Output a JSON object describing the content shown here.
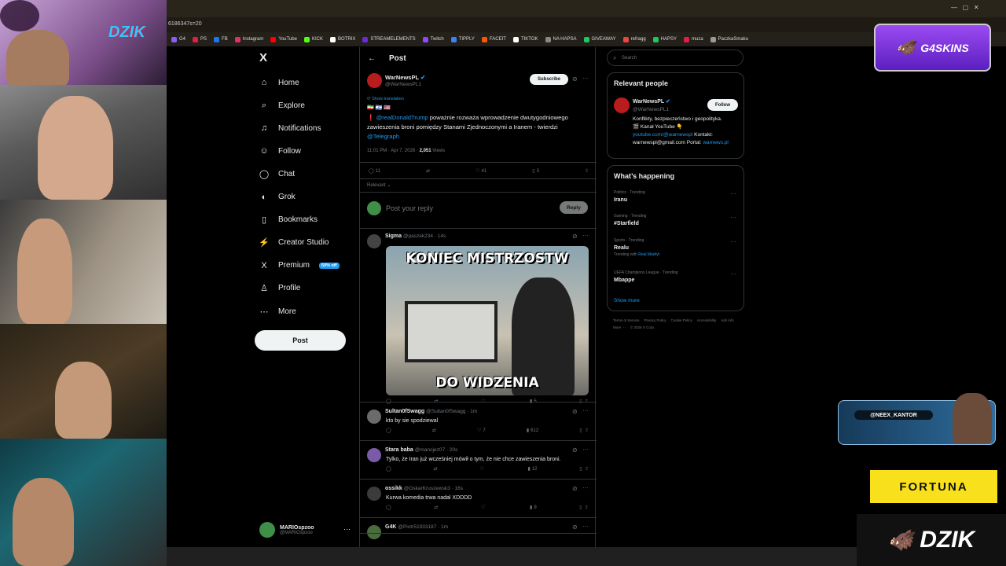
{
  "browser": {
    "url": "6186347s=20",
    "bookmarks": [
      "G4",
      "PS",
      "FB",
      "Instagram",
      "YouTube",
      "KICK",
      "BOTRIX",
      "STREAMELEMENTS",
      "Twitch",
      "TIPPLY",
      "FACEIT",
      "TIKTOK",
      "NA HAPSA",
      "GIVEAWAY",
      "refragg",
      "HAPSY",
      "muza",
      "PaczkaSmaku"
    ],
    "bookmark_colors": [
      "#8b5cf6",
      "#e11d48",
      "#1877f2",
      "#e1306c",
      "#ff0000",
      "#53fc18",
      "#ffffff",
      "#6d28d9",
      "#9146ff",
      "#3b82f6",
      "#ff5500",
      "#ffffff",
      "#888888",
      "#22c55e",
      "#ef4444",
      "#22c55e",
      "#e11d48",
      "#999999"
    ]
  },
  "sidebar": {
    "logo": "X",
    "items": [
      {
        "label": "Home",
        "icon": "home-icon",
        "glyph": "⌂"
      },
      {
        "label": "Explore",
        "icon": "search-icon",
        "glyph": "⌕"
      },
      {
        "label": "Notifications",
        "icon": "bell-icon",
        "glyph": "♫",
        "badge": "20+"
      },
      {
        "label": "Follow",
        "icon": "follow-icon",
        "glyph": "☺"
      },
      {
        "label": "Chat",
        "icon": "chat-icon",
        "glyph": "◯"
      },
      {
        "label": "Grok",
        "icon": "grok-icon",
        "glyph": "◐"
      },
      {
        "label": "Bookmarks",
        "icon": "bookmark-icon",
        "glyph": "▯"
      },
      {
        "label": "Creator Studio",
        "icon": "creator-studio-icon",
        "glyph": "⚡"
      },
      {
        "label": "Premium",
        "icon": "x-premium-icon",
        "glyph": "X",
        "badge": "50% off"
      },
      {
        "label": "Profile",
        "icon": "profile-icon",
        "glyph": "♙"
      },
      {
        "label": "More",
        "icon": "more-icon",
        "glyph": "⋯"
      }
    ],
    "post_button": "Post",
    "account": {
      "name": "MARIOspzoo",
      "handle": "@MARIOspzoo",
      "more": "···"
    }
  },
  "main": {
    "header": "Post",
    "back": "←",
    "tweet": {
      "author": "WarNewsPL",
      "handle": "@WarNewsPL1",
      "subscribe": "Subscribe",
      "translation": "Show translation",
      "flags": "🇮🇷 🇮🇱 🇺🇸",
      "mention": "❗ @realDonaldTrump",
      "text": " poważnie rozważa wprowadzenie dwutygodniowego zawieszenia broni pomiędzy Stanami Zjednoczonymi a Iranem - twierdzi ",
      "source": "@Telegraph",
      "timestamp": "11:01 PM · Apr 7, 2026 · ",
      "views_count": "2,051",
      "views_label": " Views",
      "replies": "11",
      "likes": "41",
      "bookmarks": "3",
      "sort": "Relevant ⌄"
    },
    "reply_box": {
      "placeholder": "Post your reply",
      "button": "Reply"
    },
    "replies": [
      {
        "name": "Sigma",
        "handle": "@paszek234 · 14s",
        "text": "",
        "meme_top": "KONIEC MISTRZOSTW",
        "meme_bottom": "DO WIDZENIA",
        "views": "5",
        "replies": "",
        "likes": ""
      },
      {
        "name": "Sultan0fSwagg",
        "handle": "@Sultan0fSwagg · 1m",
        "text": "kto by sie spodziewal",
        "views": "612",
        "replies": "",
        "likes": "7"
      },
      {
        "name": "Stara baba",
        "handle": "@manojez07 · 20s",
        "text": "Tylko, że Iran już wcześniej mówił o tym, że nie chce zawieszenia broni.",
        "views": "12",
        "replies": "",
        "likes": ""
      },
      {
        "name": "ossikk",
        "handle": "@OskarKruszewsk3 · 16s",
        "text": "Kurwa komedia trwa nadal XDDDD",
        "views": "9",
        "replies": "",
        "likes": ""
      },
      {
        "name": "G4K",
        "handle": "@Piotr51933187 · 1m",
        "text": "",
        "views": "",
        "replies": "",
        "likes": ""
      }
    ]
  },
  "right": {
    "search_placeholder": "Search",
    "relevant": {
      "title": "Relevant people",
      "name": "WarNewsPL",
      "handle": "@WarNewsPL1",
      "follow": "Follow",
      "bio_1": "Konflikty, bezpieczeństwo i geopolityka.",
      "bio_2": "🎬 Kanał YouTube 👇",
      "bio_link": "youtube.com/@warnewspl",
      "bio_3": " Kontakt: warnewspl@gmail.com Portal: ",
      "bio_site": "warnews.pl"
    },
    "happening": {
      "title": "What’s happening",
      "trends": [
        {
          "category": "Politics · Trending",
          "name": "Iranu",
          "extra": ""
        },
        {
          "category": "Gaming · Trending",
          "name": "#Starfield",
          "extra": ""
        },
        {
          "category": "Sports · Trending",
          "name": "Realu",
          "extra": "Trending with ",
          "extra_link": "Real Madryt"
        },
        {
          "category": "UEFA Champions League · Trending",
          "name": "Mbappe",
          "extra": ""
        }
      ],
      "show_more": "Show more"
    },
    "footer": [
      "Terms of Service",
      "Privacy Policy",
      "Cookie Policy",
      "Accessibility",
      "Ads info",
      "More ···",
      "© 2026 X Corp."
    ]
  },
  "overlays": {
    "g4skins": "G4SKINS",
    "dzik_top": "DZIK",
    "neex_tag": "@NEEX_KANTOR",
    "fortuna": "FORTUNA",
    "dzik_bottom": "DZIK"
  },
  "colors": {
    "accent": "#1d9bf0",
    "premium": "#1d9bf0",
    "brand_purple": "#7c3aed",
    "fortuna": "#f8e11c"
  }
}
